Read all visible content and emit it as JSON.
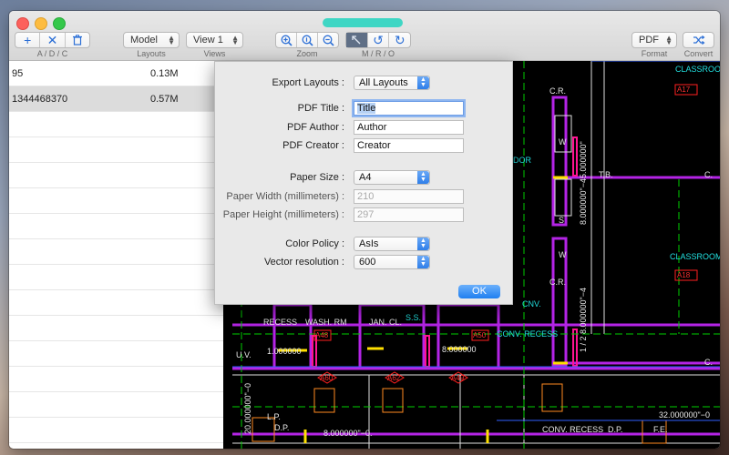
{
  "toolbar": {
    "add_remove_clear_label": "A / D / C",
    "layouts": {
      "value": "Model",
      "label": "Layouts"
    },
    "views": {
      "value": "View 1",
      "label": "Views"
    },
    "zoom_label": "Zoom",
    "mro_label": "M / R / O",
    "format": {
      "value": "PDF",
      "label": "Format"
    },
    "convert_label": "Convert"
  },
  "files": [
    {
      "name": "95",
      "size": "0.13M",
      "selected": false
    },
    {
      "name": "1344468370",
      "size": "0.57M",
      "selected": true
    }
  ],
  "export_dialog": {
    "export_layouts_label": "Export Layouts :",
    "export_layouts_value": "All Layouts",
    "pdf_title_label": "PDF Title :",
    "pdf_title_value": "Title",
    "pdf_author_label": "PDF Author :",
    "pdf_author_value": "Author",
    "pdf_creator_label": "PDF Creator :",
    "pdf_creator_value": "Creator",
    "paper_size_label": "Paper Size :",
    "paper_size_value": "A4",
    "paper_width_label": "Paper Width (millimeters) :",
    "paper_width_value": "210",
    "paper_height_label": "Paper Height (millimeters) :",
    "paper_height_value": "297",
    "color_policy_label": "Color Policy :",
    "color_policy_value": "AsIs",
    "vector_resolution_label": "Vector resolution :",
    "vector_resolution_value": "600",
    "ok_label": "OK"
  },
  "drawing_text": {
    "classroom_1": "CLASSROOM",
    "a17": "A17",
    "cr_1": "C.R.",
    "dor": "DOR",
    "w_1": "W",
    "dim_1": "8.000000\"−45.000000\"",
    "tb": "T.B.",
    "c_1": "C.",
    "s_1": "S",
    "w_2": "W",
    "dim_2": "1 / 2  8.000000\"−4",
    "cr_2": "C.R.",
    "classroom_2": "CLASSROOM",
    "a18": "A18",
    "cnv": "CNV.",
    "recess_1": "RECESS",
    "wash_rm": "WASH. RM",
    "jan_cl": "JAN. CL.",
    "a48": "A48",
    "a50": "A50",
    "conv_recess_1": "CONV. RECESS",
    "uv": "U.V.",
    "dim_3": "1.000000",
    "ss": "S.S.",
    "a60": "A60",
    "a62": "A62",
    "a49": "A49",
    "dim_4": "8.000000",
    "lp": "L.P.",
    "dp": "D.P.",
    "dim_5": "8.000000\"−0.",
    "conv_recess_2": "CONV. RECESS",
    "dp_2": "D.P.",
    "fe": "F.E.",
    "dim_6": "32.000000\"−0",
    "dim_7": "20.000000\"−0",
    "c_2": "C."
  }
}
